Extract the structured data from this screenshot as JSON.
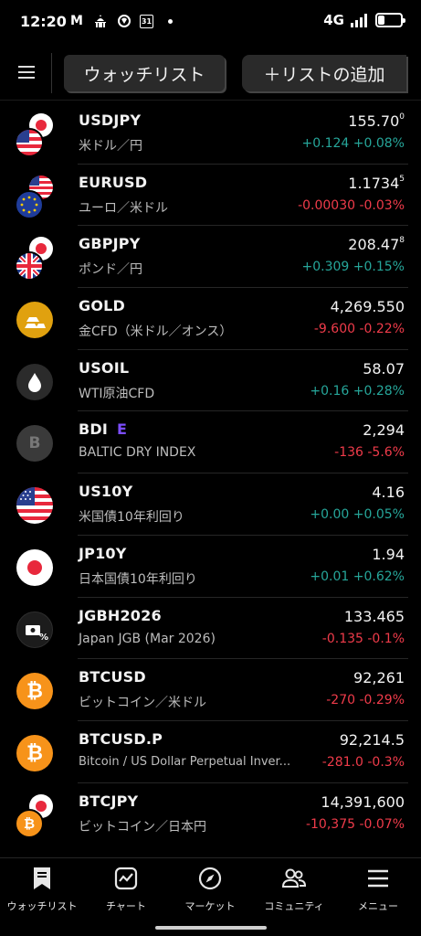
{
  "status_bar": {
    "time": "12:20",
    "icons": [
      "gmail-icon",
      "mosque-icon",
      "notification-icon",
      "calendar-icon",
      "dot-icon"
    ],
    "calendar_day": "31",
    "network": "4G",
    "battery_level": 0.3
  },
  "header": {
    "menu_icon": "hamburger-icon",
    "watchlist_label": "ウォッチリスト",
    "add_list_label": "＋リストの追加"
  },
  "rows": [
    {
      "symbol": "USDJPY",
      "desc": "米ドル／円",
      "price_main": "155.70",
      "price_sup": "0",
      "change": "+0.124",
      "pct": "+0.08%",
      "dir": "up",
      "icon": "usd-jpy-flags-icon"
    },
    {
      "symbol": "EURUSD",
      "desc": "ユーロ／米ドル",
      "price_main": "1.1734",
      "price_sup": "5",
      "change": "-0.00030",
      "pct": "-0.03%",
      "dir": "dn",
      "icon": "eur-usd-flags-icon"
    },
    {
      "symbol": "GBPJPY",
      "desc": "ポンド／円",
      "price_main": "208.47",
      "price_sup": "8",
      "change": "+0.309",
      "pct": "+0.15%",
      "dir": "up",
      "icon": "gbp-jpy-flags-icon"
    },
    {
      "symbol": "GOLD",
      "desc": "金CFD（米ドル／オンス）",
      "price_main": "4,269.550",
      "price_sup": "",
      "change": "-9.600",
      "pct": "-0.22%",
      "dir": "dn",
      "icon": "gold-bars-icon"
    },
    {
      "symbol": "USOIL",
      "desc": "WTI原油CFD",
      "price_main": "58.07",
      "price_sup": "",
      "change": "+0.16",
      "pct": "+0.28%",
      "dir": "up",
      "icon": "oil-drop-icon"
    },
    {
      "symbol": "BDI",
      "badge": "E",
      "desc": "BALTIC DRY INDEX",
      "price_main": "2,294",
      "price_sup": "",
      "change": "-136",
      "pct": "-5.6%",
      "dir": "dn",
      "icon": "letter-b-icon"
    },
    {
      "symbol": "US10Y",
      "desc": "米国債10年利回り",
      "price_main": "4.16",
      "price_sup": "",
      "change": "+0.00",
      "pct": "+0.05%",
      "dir": "up",
      "icon": "us-flag-icon"
    },
    {
      "symbol": "JP10Y",
      "desc": "日本国債10年利回り",
      "price_main": "1.94",
      "price_sup": "",
      "change": "+0.01",
      "pct": "+0.62%",
      "dir": "up",
      "icon": "japan-flag-icon"
    },
    {
      "symbol": "JGBH2026",
      "desc": "Japan JGB (Mar 2026)",
      "price_main": "133.465",
      "price_sup": "",
      "change": "-0.135",
      "pct": "-0.1%",
      "dir": "dn",
      "icon": "bond-percent-icon"
    },
    {
      "symbol": "BTCUSD",
      "desc": "ビットコイン／米ドル",
      "price_main": "92,261",
      "price_sup": "",
      "change": "-270",
      "pct": "-0.29%",
      "dir": "dn",
      "icon": "bitcoin-icon"
    },
    {
      "symbol": "BTCUSD.P",
      "desc": "Bitcoin / US Dollar Perpetual Inver...",
      "price_main": "92,214.5",
      "price_sup": "",
      "change": "-281.0",
      "pct": "-0.3%",
      "dir": "dn",
      "icon": "bitcoin-icon"
    },
    {
      "symbol": "BTCJPY",
      "desc": "ビットコイン／日本円",
      "price_main": "14,391,600",
      "price_sup": "",
      "change": "-10,375",
      "pct": "-0.07%",
      "dir": "dn",
      "icon": "btc-jpy-icon"
    }
  ],
  "nav": [
    {
      "label": "ウォッチリスト",
      "icon": "bookmark-list-icon"
    },
    {
      "label": "チャート",
      "icon": "chart-icon"
    },
    {
      "label": "マーケット",
      "icon": "compass-icon"
    },
    {
      "label": "コミュニティ",
      "icon": "community-icon"
    },
    {
      "label": "メニュー",
      "icon": "menu-icon"
    }
  ],
  "colors": {
    "up": "#26a69a",
    "down": "#ef3b4a",
    "badge": "#7c4dff",
    "gold": "#e0a10f",
    "bitcoin": "#f7931a"
  }
}
